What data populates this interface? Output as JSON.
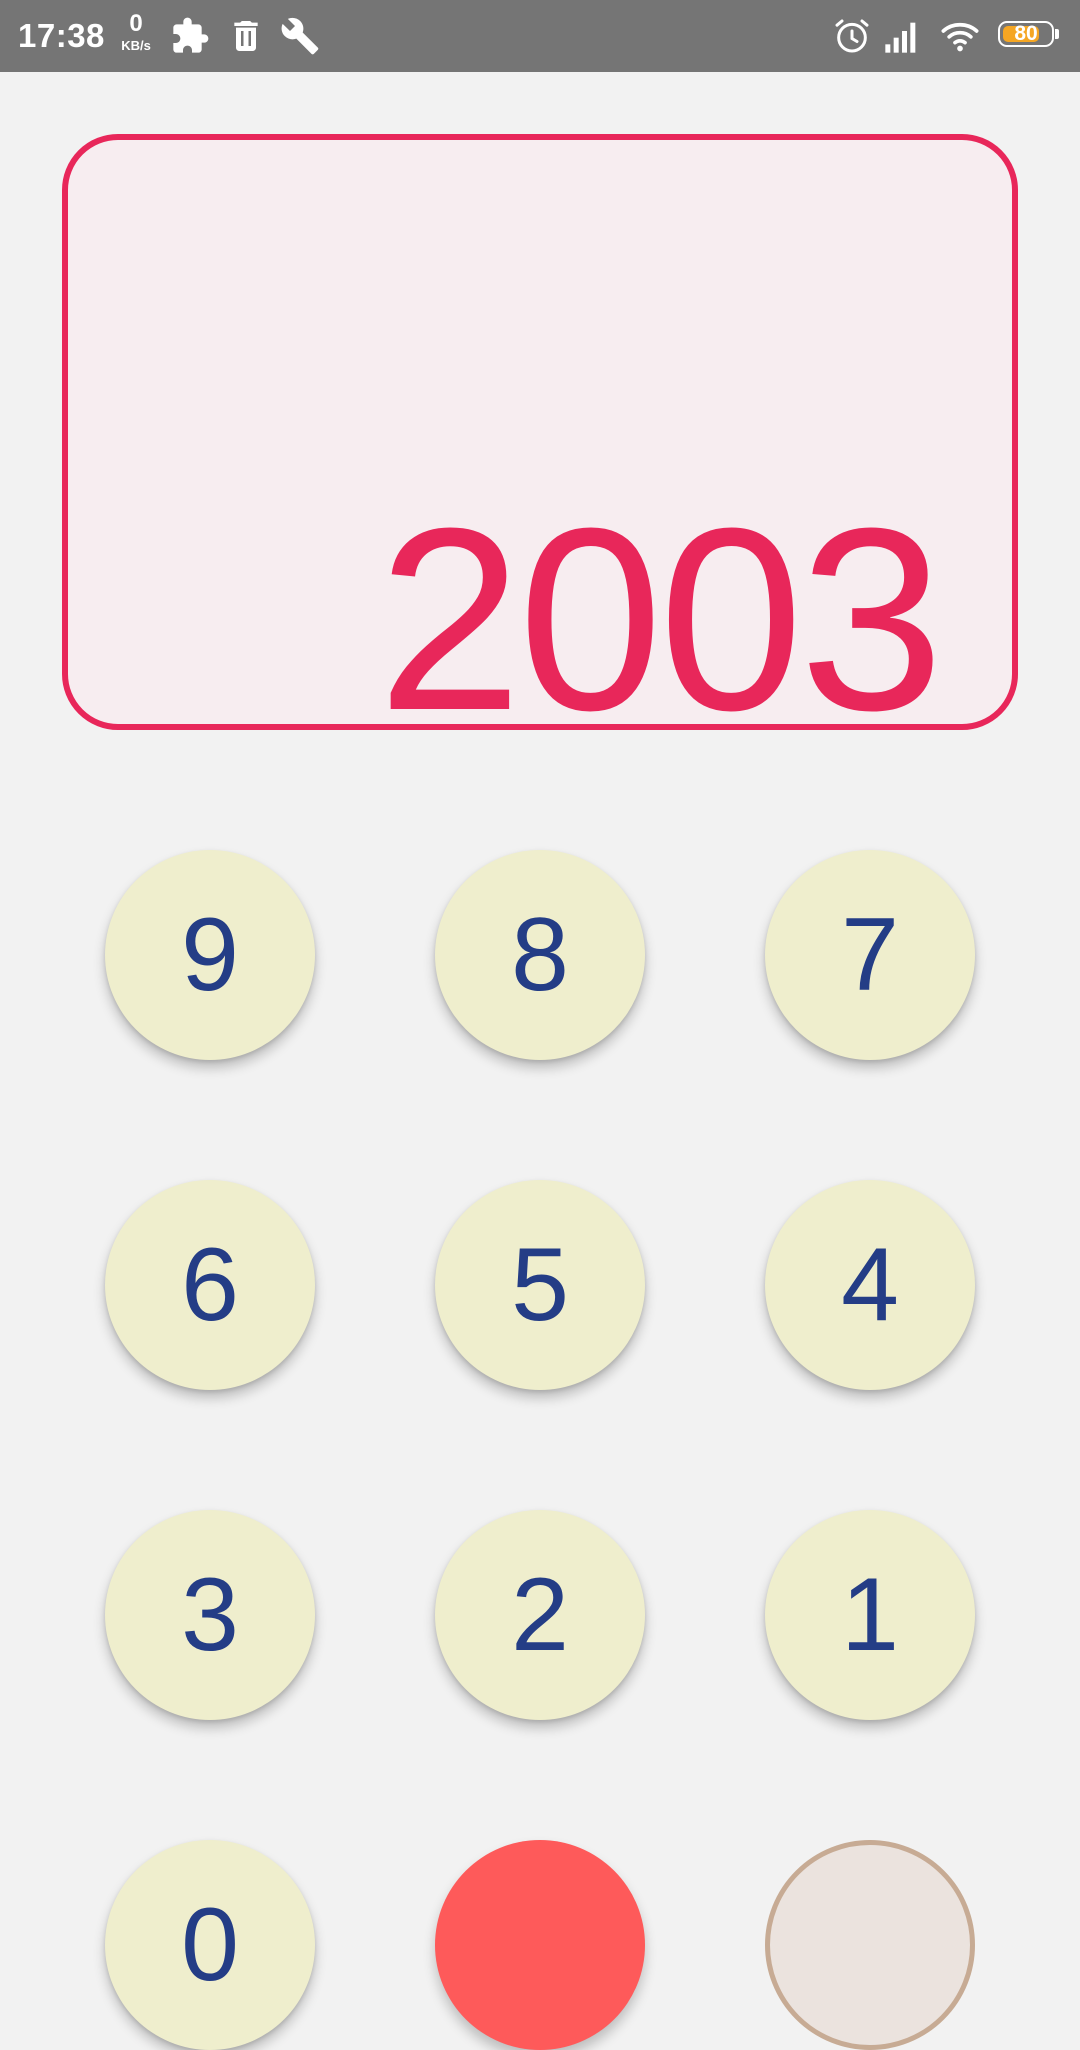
{
  "status_bar": {
    "time": "17:38",
    "net_speed_value": "0",
    "net_speed_unit": "KB/s",
    "battery_level": "80",
    "battery_fraction": 0.8
  },
  "display": {
    "value": "2003"
  },
  "keypad": {
    "key_9": "9",
    "key_8": "8",
    "key_7": "7",
    "key_6": "6",
    "key_5": "5",
    "key_4": "4",
    "key_3": "3",
    "key_2": "2",
    "key_1": "1",
    "key_0": "0"
  },
  "colors": {
    "accent": "#e8275a",
    "display_bg": "#f7edf0",
    "key_bg": "#efeecd",
    "key_text": "#243d86",
    "clear_button": "#fe5a5a",
    "status_bar": "#757575"
  }
}
